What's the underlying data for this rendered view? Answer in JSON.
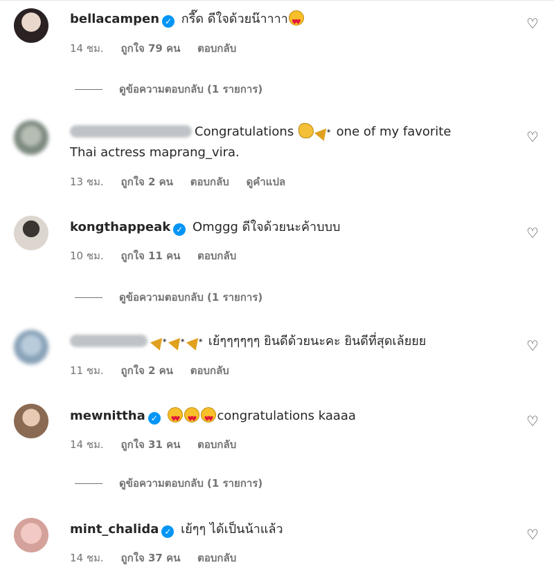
{
  "comments": [
    {
      "username": "bellacampen",
      "text": "กรี๊ด ดีใจด้วยน๊าาาา",
      "time": "14 ชม.",
      "likes": "ถูกใจ 79 คน",
      "reply": "ตอบกลับ",
      "view_replies": "ดูข้อความตอบกลับ (1 รายการ)"
    },
    {
      "text_line1a": "Congratulations",
      "text_line1b": "one of my favorite",
      "text_line2": "Thai actress maprang_vira.",
      "time": "13 ชม.",
      "likes": "ถูกใจ 2 คน",
      "reply": "ตอบกลับ",
      "translate": "ดูคำแปล"
    },
    {
      "username": "kongthappeak",
      "text": "Omggg ดีใจด้วยนะค้าบบบ",
      "time": "10 ชม.",
      "likes": "ถูกใจ 11 คน",
      "reply": "ตอบกลับ",
      "view_replies": "ดูข้อความตอบกลับ (1 รายการ)"
    },
    {
      "text": "เย้ๆๆๆๆๆๆ ยินดีด้วยนะคะ ยินดีที่สุดเล้ยยย",
      "time": "11 ชม.",
      "likes": "ถูกใจ 2 คน",
      "reply": "ตอบกลับ"
    },
    {
      "username": "mewnittha",
      "text": "congratulations kaaaa",
      "time": "14 ชม.",
      "likes": "ถูกใจ 31 คน",
      "reply": "ตอบกลับ",
      "view_replies": "ดูข้อความตอบกลับ (1 รายการ)"
    },
    {
      "username": "mint_chalida",
      "text": "เย้ๆๆ ได้เป็นน้าแล้ว",
      "time": "14 ชม.",
      "likes": "ถูกใจ 37 คน",
      "reply": "ตอบกลับ"
    }
  ],
  "icons": {
    "like": "heart-outline-icon",
    "verified": "verified-badge-icon"
  },
  "colors": {
    "verified": "#0095f6",
    "meta": "#737373",
    "text": "#262626"
  }
}
